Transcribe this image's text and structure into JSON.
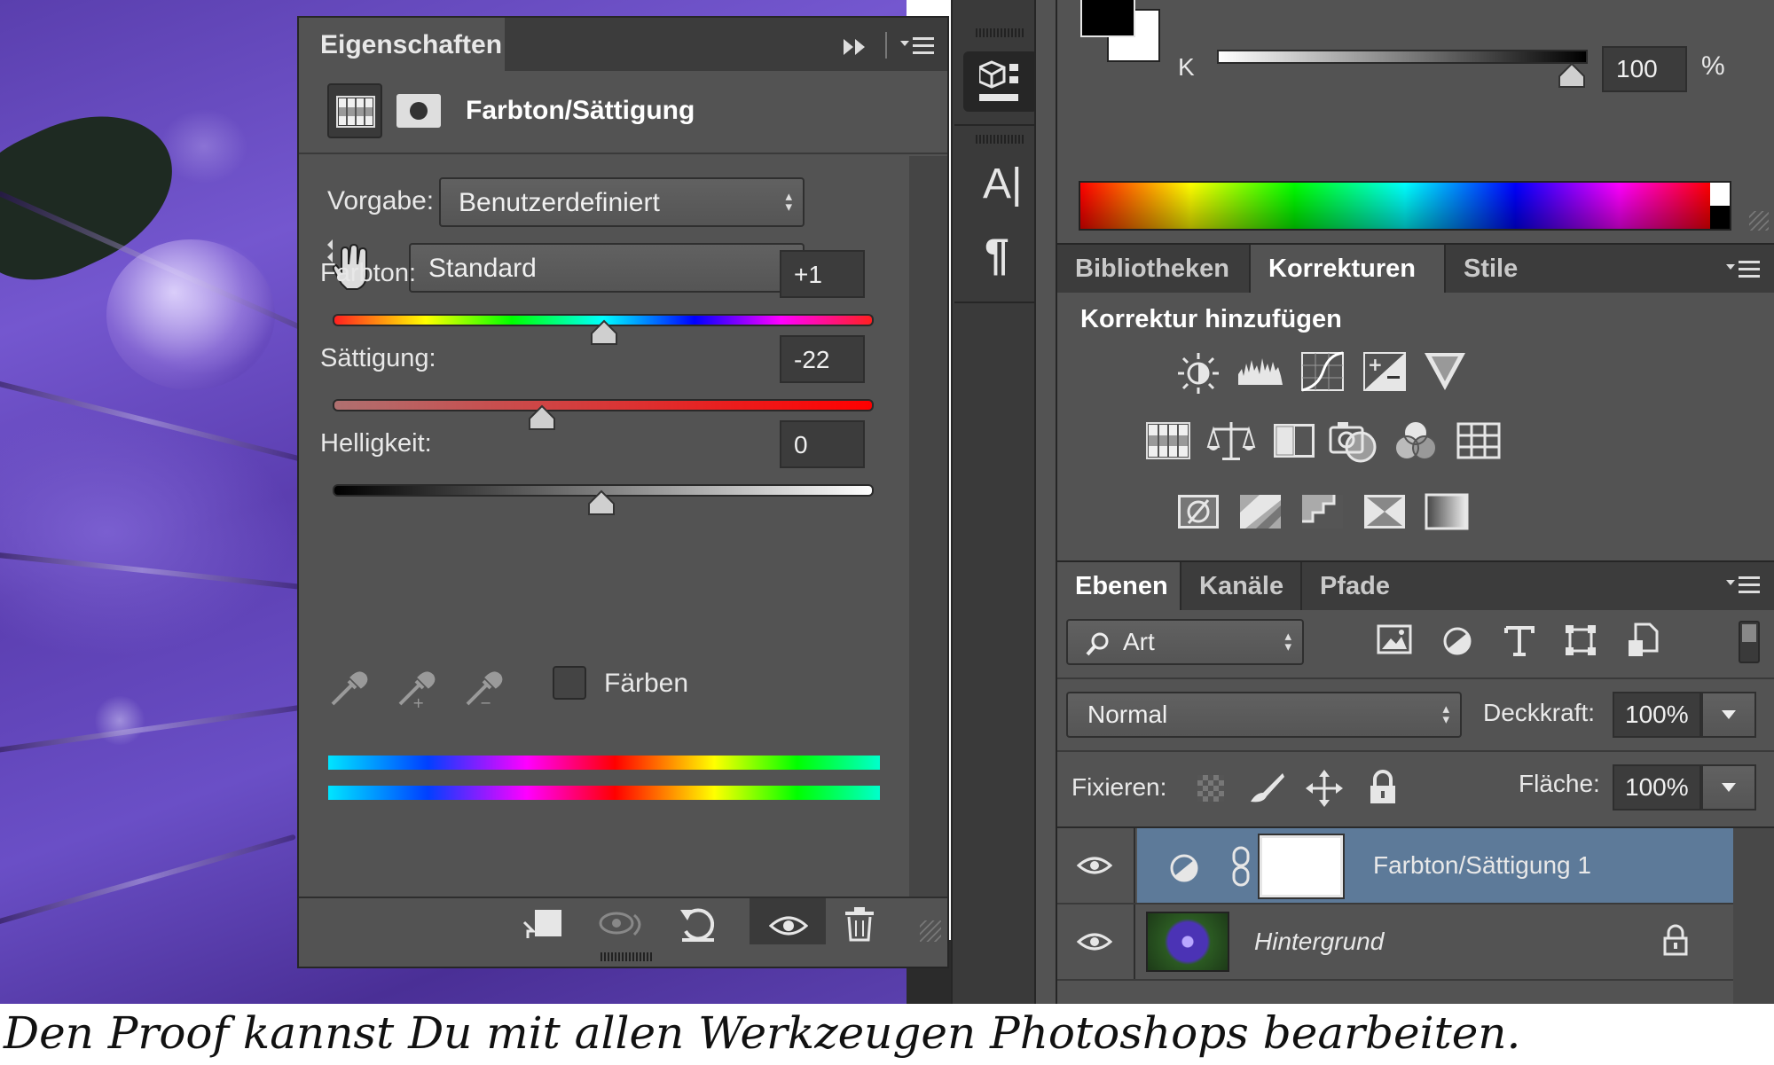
{
  "properties_panel": {
    "title": "Eigenschaften",
    "adjustment_name": "Farbton/Sättigung",
    "preset_label": "Vorgabe:",
    "preset_value": "Benutzerdefiniert",
    "range_value": "Standard",
    "sliders": [
      {
        "label": "Farbton:",
        "value": "+1",
        "position": 0.505
      },
      {
        "label": "Sättigung:",
        "value": "-22",
        "position": 0.39
      },
      {
        "label": "Helligkeit:",
        "value": "0",
        "position": 0.5
      }
    ],
    "colorize_label": "Färben"
  },
  "color_panel": {
    "channel_label": "K",
    "value": "100",
    "unit": "%",
    "slider_position": 1.0
  },
  "adjustments_panel": {
    "tabs": [
      "Bibliotheken",
      "Korrekturen",
      "Stile"
    ],
    "active_tab": "Korrekturen",
    "heading": "Korrektur hinzufügen"
  },
  "layers_panel": {
    "tabs": [
      "Ebenen",
      "Kanäle",
      "Pfade"
    ],
    "active_tab": "Ebenen",
    "filter_value": "Art",
    "blend_mode": "Normal",
    "opacity_label": "Deckkraft:",
    "opacity_value": "100%",
    "lock_label": "Fixieren:",
    "fill_label": "Fläche:",
    "fill_value": "100%",
    "layers": [
      {
        "name": "Farbton/Sättigung 1",
        "selected": true
      },
      {
        "name": "Hintergrund",
        "selected": false
      }
    ]
  },
  "caption": "Den Proof kannst Du mit allen Werkzeugen Photoshops bearbeiten.",
  "colors": {
    "panel_bg": "#535353",
    "dark_bg": "#3b3b3b",
    "selection": "#5d7a99",
    "text": "#e8e8e8"
  }
}
